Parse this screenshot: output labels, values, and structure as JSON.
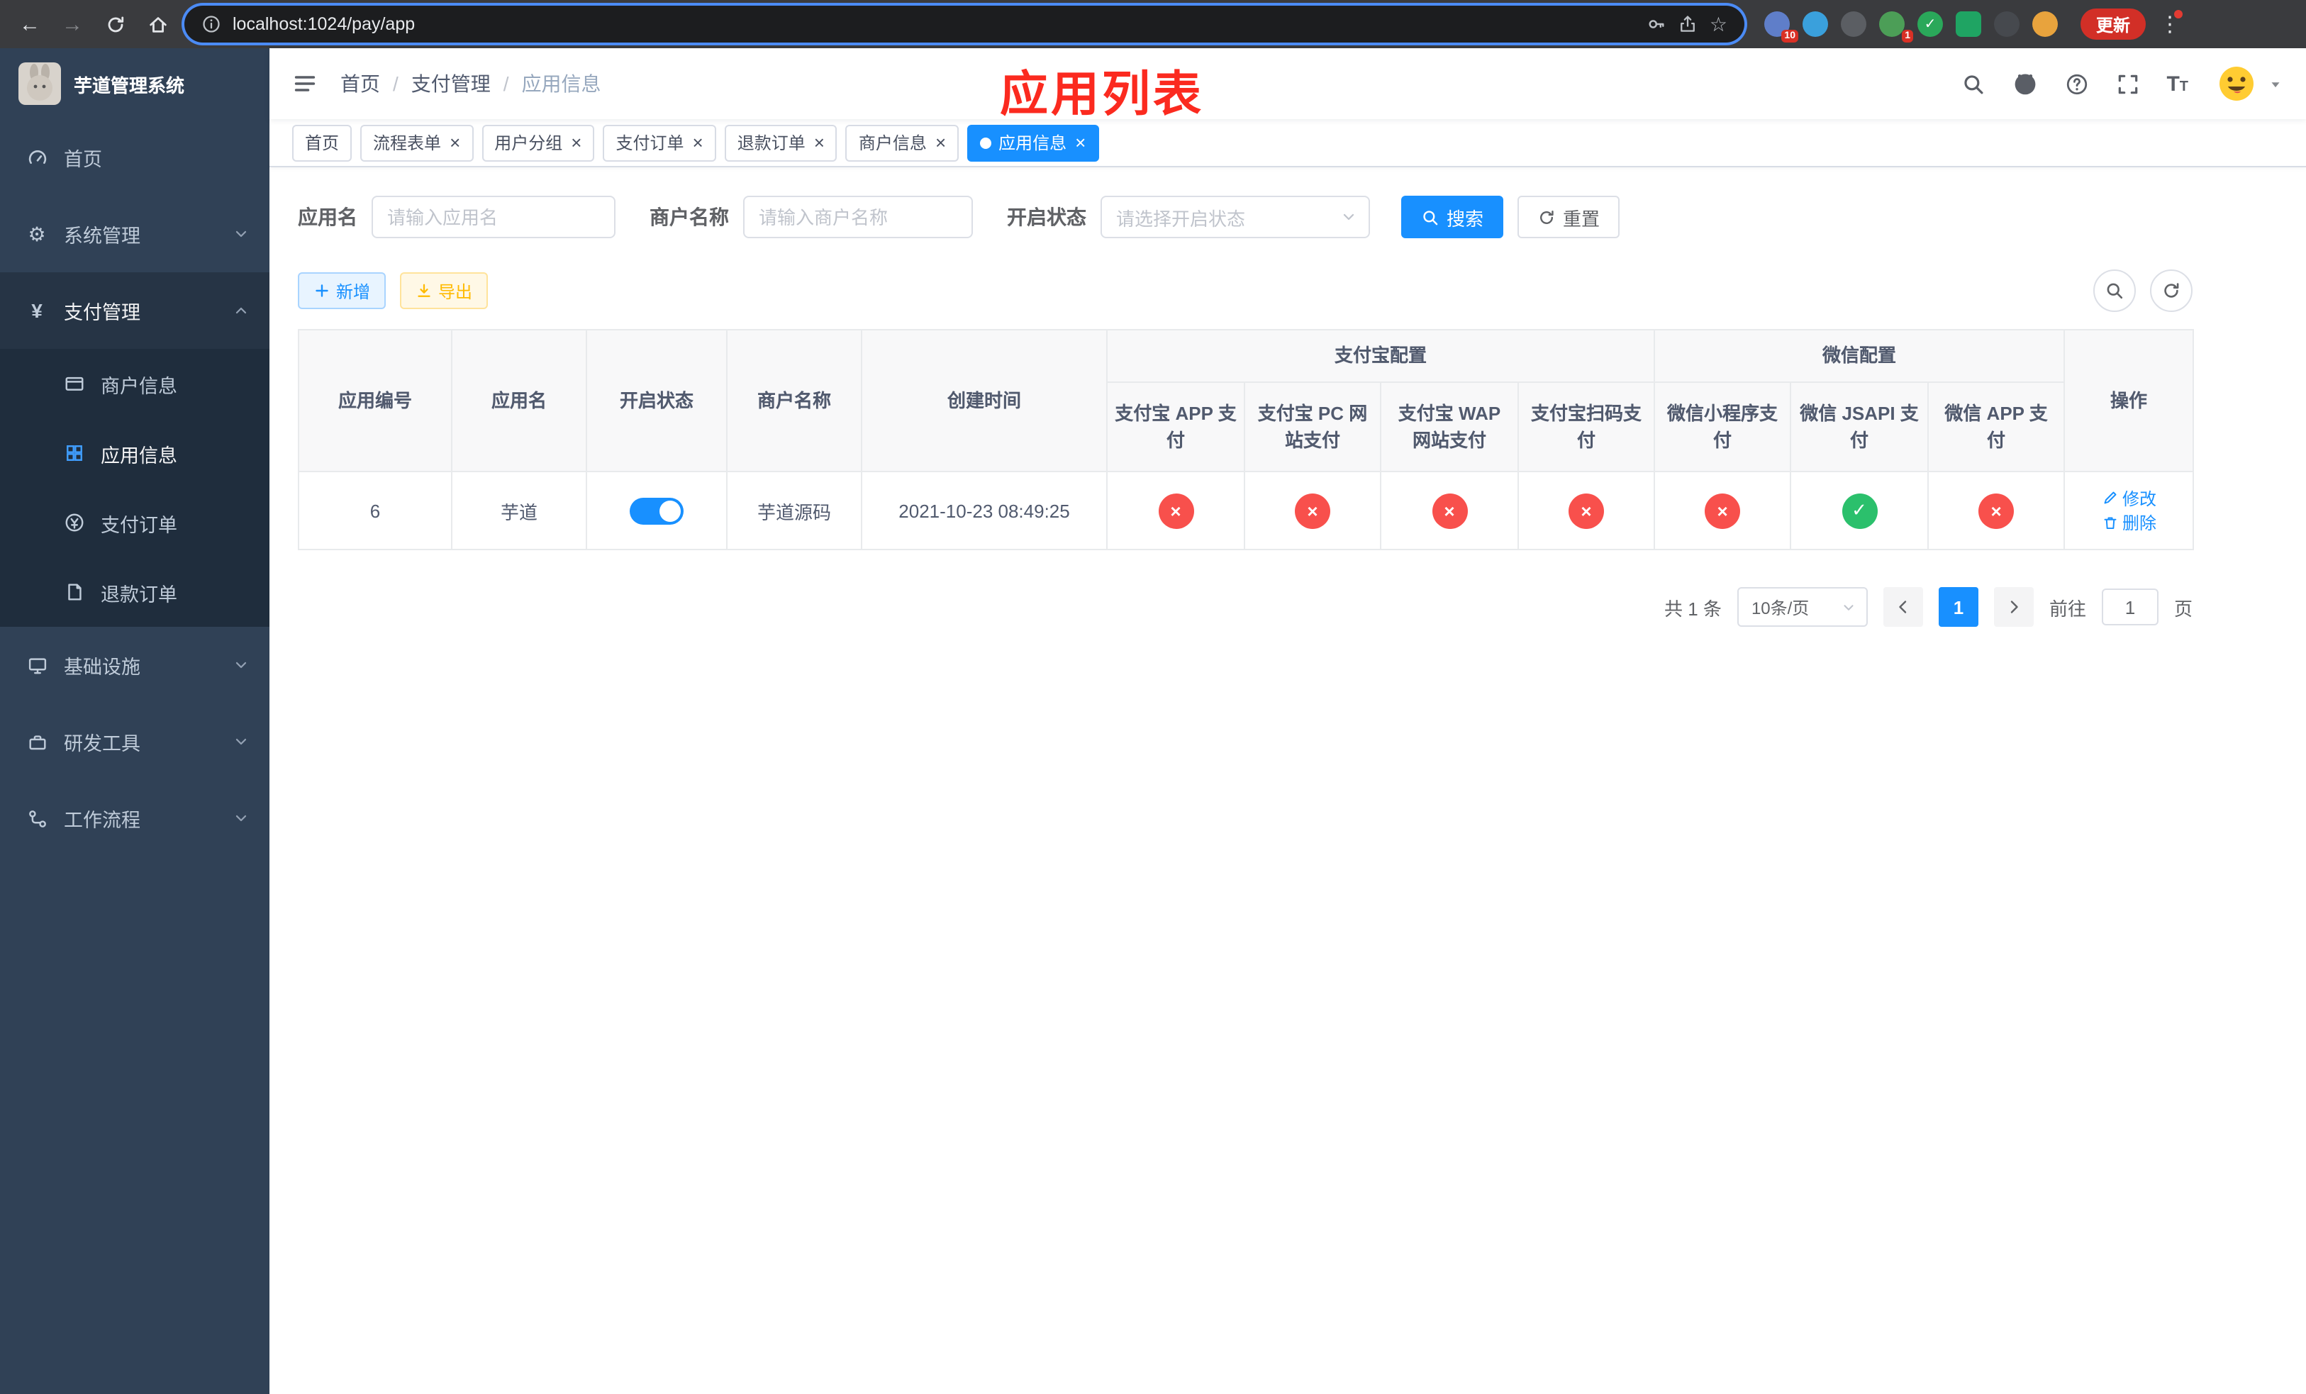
{
  "theme": {
    "primary": "#1890ff",
    "danger": "#f8504c",
    "success": "#2bc06c",
    "warning": "#ffba00",
    "annotation": "#fb2a1f",
    "sidebar": "#304156",
    "sidebar_active": "#409eff"
  },
  "browser": {
    "url": "localhost:1024/pay/app",
    "update_label": "更新",
    "ext_badge_1": "10",
    "ext_badge_2": "1"
  },
  "sidebar": {
    "title": "芋道管理系统",
    "items": [
      {
        "label": "首页"
      },
      {
        "label": "系统管理"
      },
      {
        "label": "支付管理",
        "children": [
          {
            "label": "商户信息"
          },
          {
            "label": "应用信息"
          },
          {
            "label": "支付订单"
          },
          {
            "label": "退款订单"
          }
        ]
      },
      {
        "label": "基础设施"
      },
      {
        "label": "研发工具"
      },
      {
        "label": "工作流程"
      }
    ]
  },
  "header": {
    "breadcrumb": [
      "首页",
      "支付管理",
      "应用信息"
    ],
    "annotation": "应用列表"
  },
  "tabs": [
    {
      "label": "首页"
    },
    {
      "label": "流程表单"
    },
    {
      "label": "用户分组"
    },
    {
      "label": "支付订单"
    },
    {
      "label": "退款订单"
    },
    {
      "label": "商户信息"
    },
    {
      "label": "应用信息"
    }
  ],
  "filters": {
    "app_name_label": "应用名",
    "app_name_placeholder": "请输入应用名",
    "merchant_label": "商户名称",
    "merchant_placeholder": "请输入商户名称",
    "status_label": "开启状态",
    "status_placeholder": "请选择开启状态",
    "search_label": "搜索",
    "reset_label": "重置"
  },
  "toolbar": {
    "add_label": "新增",
    "export_label": "导出"
  },
  "table": {
    "col_app_id": "应用编号",
    "col_app_name": "应用名",
    "col_status": "开启状态",
    "col_merchant": "商户名称",
    "col_created": "创建时间",
    "group_alipay": "支付宝配置",
    "group_wechat": "微信配置",
    "sub_cols": [
      "支付宝 APP 支付",
      "支付宝 PC 网站支付",
      "支付宝 WAP 网站支付",
      "支付宝扫码支付",
      "微信小程序支付",
      "微信 JSAPI 支付",
      "微信 APP 支付"
    ],
    "col_actions": "操作",
    "row": {
      "id": "6",
      "name": "芋道",
      "status_on": true,
      "merchant": "芋道源码",
      "created": "2021-10-23 08:49:25",
      "configs": [
        false,
        false,
        false,
        false,
        false,
        true,
        false
      ]
    },
    "edit_label": "修改",
    "delete_label": "删除"
  },
  "pagination": {
    "total": "共 1 条",
    "page_size": "10条/页",
    "current_page": "1",
    "goto_label": "前往",
    "goto_value": "1",
    "unit_label": "页"
  }
}
